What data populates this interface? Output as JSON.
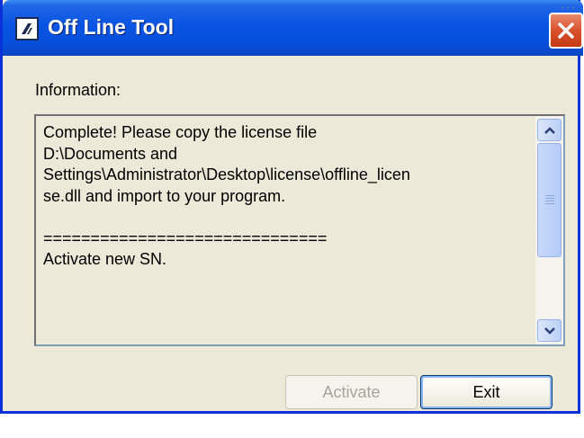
{
  "window": {
    "title": "Off Line Tool",
    "icon": "app-icon",
    "close_icon": "close-icon"
  },
  "info": {
    "label": "Information:",
    "text": "Complete! Please copy the license file\nD:\\Documents and\nSettings\\Administrator\\Desktop\\license\\offline_licen\nse.dll and import to your program.\n\n==============================\nActivate new SN."
  },
  "buttons": {
    "activate": "Activate",
    "exit": "Exit"
  },
  "colors": {
    "titlebar": "#0a54e3",
    "window_bg": "#ece9d8",
    "close_button": "#d9512c",
    "disabled_text": "#a8a496"
  }
}
